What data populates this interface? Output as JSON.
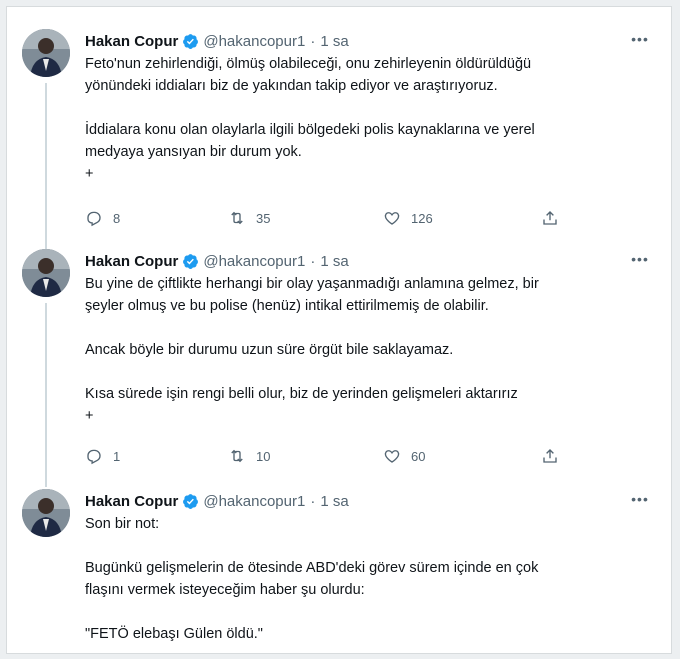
{
  "tweets": [
    {
      "author": "Hakan Copur",
      "handle": "@hakancopur1",
      "time": "1 sa",
      "lines": [
        "Feto'nun zehirlendiği, ölmüş olabileceği, onu zehirleyenin öldürüldüğü",
        "yönündeki iddiaları biz de yakından takip ediyor ve araştırıyoruz.",
        "",
        "İddialara konu olan olaylarla ilgili bölgedeki polis kaynaklarına ve yerel",
        "medyaya yansıyan bir durum yok.",
        "+"
      ],
      "replies": "8",
      "retweets": "35",
      "likes": "126"
    },
    {
      "author": "Hakan Copur",
      "handle": "@hakancopur1",
      "time": "1 sa",
      "lines": [
        "Bu yine de çiftlikte herhangi bir olay yaşanmadığı anlamına gelmez, bir",
        "şeyler olmuş ve bu polise (henüz) intikal ettirilmemiş de olabilir.",
        "",
        "Ancak böyle bir durumu uzun süre örgüt bile saklayamaz.",
        "",
        "Kısa sürede işin rengi belli olur, biz de yerinden gelişmeleri aktarırız",
        "+"
      ],
      "replies": "1",
      "retweets": "10",
      "likes": "60"
    },
    {
      "author": "Hakan Copur",
      "handle": "@hakancopur1",
      "time": "1 sa",
      "lines": [
        "Son bir not:",
        "",
        "Bugünkü gelişmelerin de ötesinde ABD'deki görev sürem içinde en çok",
        "flaşını vermek isteyeceğim haber şu olurdu:",
        "",
        "\"FETÖ elebaşı Gülen öldü.\""
      ]
    }
  ],
  "icons": {
    "verified": "verified-badge-icon",
    "more": "more-icon",
    "reply": "reply-icon",
    "retweet": "retweet-icon",
    "like": "like-icon",
    "share": "share-icon"
  },
  "colors": {
    "verified": "#1d9bf0",
    "text": "#0f1419",
    "muted": "#536471",
    "thread_line": "#cfd9de"
  },
  "more_label": "•••"
}
